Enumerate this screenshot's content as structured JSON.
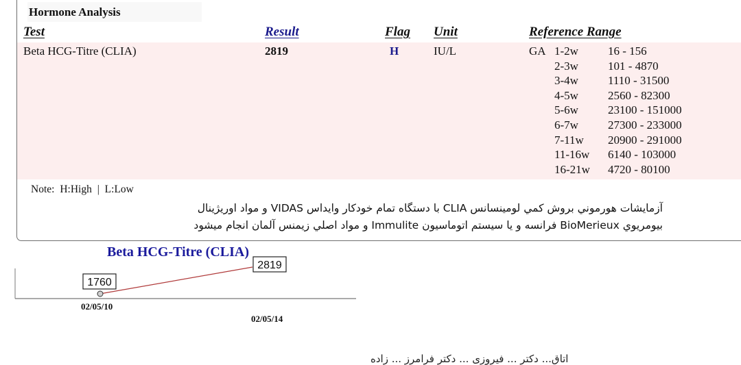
{
  "section": {
    "title": "Hormone Analysis"
  },
  "table": {
    "headers": {
      "test": "Test",
      "result": "Result",
      "flag": "Flag",
      "unit": "Unit",
      "reference": "Reference Range"
    },
    "row": {
      "test": "Beta HCG-Titre (CLIA)",
      "result": "2819",
      "flag": "H",
      "unit": "IU/L",
      "ga_label": "GA",
      "reference_ranges": [
        {
          "age": "1-2w",
          "range": "16 - 156"
        },
        {
          "age": "2-3w",
          "range": "101 - 4870"
        },
        {
          "age": "3-4w",
          "range": "1110 - 31500"
        },
        {
          "age": "4-5w",
          "range": "2560 - 82300"
        },
        {
          "age": "5-6w",
          "range": "23100 - 151000"
        },
        {
          "age": "6-7w",
          "range": "27300 - 233000"
        },
        {
          "age": "7-11w",
          "range": "20900 - 291000"
        },
        {
          "age": "11-16w",
          "range": "6140 - 103000"
        },
        {
          "age": "16-21w",
          "range": "4720 - 80100"
        }
      ]
    }
  },
  "note": {
    "label": "Note:",
    "high": "H:High",
    "separator": "|",
    "low": "L:Low"
  },
  "method_text": {
    "line1": "آزمایشات هورموني بروش کمي لومينسانس CLIA با دستگاه تمام خودکار وایداس VIDAS و مواد اوريژينال",
    "line2": "بیومریوي BioMerieux فرانسه و یا سيستم اتوماسيون Immulite و مواد اصلي زيمنس آلمان انجام میشود"
  },
  "chart_data": {
    "type": "line",
    "title": "Beta HCG-Titre (CLIA)",
    "x": [
      "02/05/10",
      "02/05/14"
    ],
    "values": [
      1760,
      2819
    ],
    "data_labels": [
      "1760",
      "2819"
    ],
    "xlabel": "",
    "ylabel": "",
    "line_color": "#b03a3a",
    "grid": false
  },
  "signature": {
    "text": "اتاق... دکتر ... فیروزی ... دکتر فرامرز ... زاده"
  }
}
